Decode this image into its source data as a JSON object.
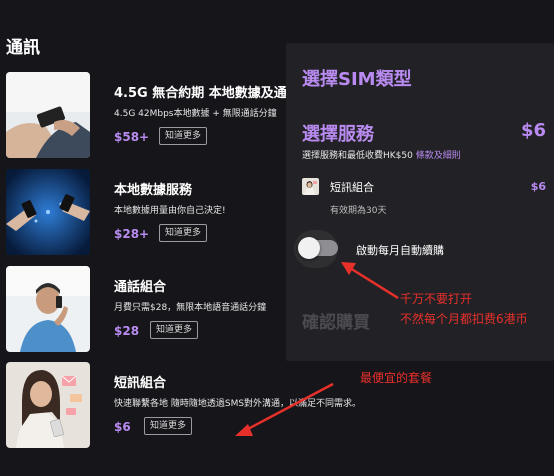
{
  "section_title": "通訊",
  "plans": [
    {
      "name": "4.5G 無合約期 本地數據及通",
      "desc": "4.5G 42Mbps本地數據 + 無限通話分鐘",
      "price": "$58+",
      "learn_more": "知道更多"
    },
    {
      "name": "本地數據服務",
      "desc": "本地數據用量由你自己決定!",
      "price": "$28+",
      "learn_more": "知道更多"
    },
    {
      "name": "通話組合",
      "desc": "月費只需$28，無限本地語音通話分鐘",
      "price": "$28",
      "learn_more": "知道更多"
    },
    {
      "name": "短訊組合",
      "desc": "快速聯繫各地 隨時隨地透過SMS對外溝通，以滿足不同需求。",
      "price": "$6",
      "learn_more": "知道更多"
    }
  ],
  "panel": {
    "title": "選擇SIM類型",
    "service_label": "選擇服務",
    "service_price": "$6",
    "service_note": "選擇服務和最低收費HK$50 ",
    "service_note_link": "條款及細則",
    "item_name": "短訊組合",
    "item_price": "$6",
    "item_validity": "有效期為30天",
    "toggle_label": "啟動每月自動續購",
    "toggle_on": false,
    "confirm": "確認購買"
  },
  "annotations": {
    "warning_line1": "千万不要打开",
    "warning_line2": "不然每个月都扣费6港币",
    "cheapest": "最便宜的套餐"
  },
  "colors": {
    "accent": "#b98bf0",
    "annotation": "#e8302b",
    "background": "#16161a",
    "panel": "#222226"
  }
}
